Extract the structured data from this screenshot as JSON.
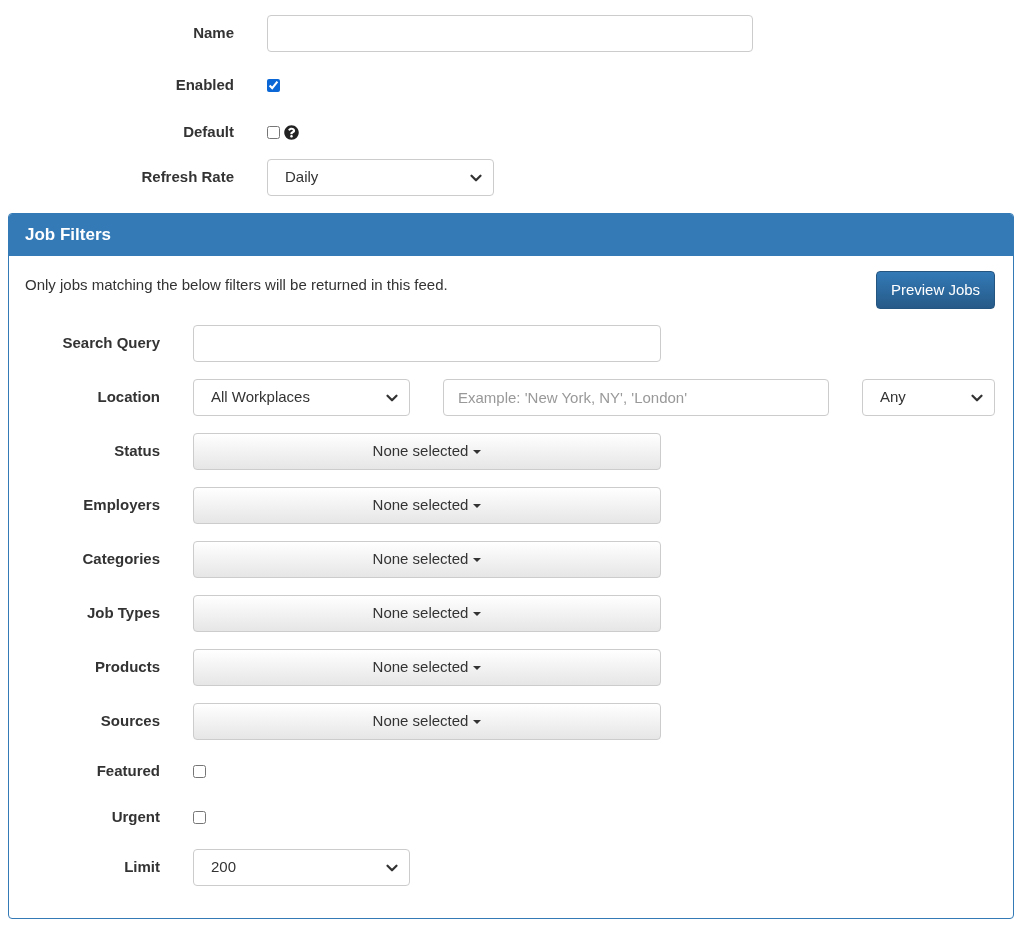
{
  "settings": [
    {
      "label": "Name",
      "controls": [
        {
          "kind": "text"
        }
      ]
    },
    {
      "label": "Enabled",
      "controls": [
        {
          "kind": "checkbox",
          "checked": true
        }
      ]
    },
    {
      "label": "Default",
      "controls": [
        {
          "kind": "checkbox",
          "checked": false,
          "help": true
        }
      ]
    },
    {
      "label": "Refresh Rate",
      "controls": [
        {
          "kind": "select",
          "value": "Daily"
        }
      ]
    }
  ],
  "panel": {
    "title": "Job Filters",
    "intro": "Only jobs matching the below filters will be returned in this feed.",
    "button": "Preview Jobs",
    "rows": [
      {
        "label": "Search Query",
        "controls": [
          {
            "kind": "text"
          }
        ]
      },
      {
        "label": "Location",
        "controls": [
          {
            "kind": "select",
            "value": "All Workplaces"
          },
          {
            "kind": "text",
            "placeholder": "Example: 'New York, NY', 'London'"
          },
          {
            "kind": "select",
            "value": "Any"
          }
        ]
      },
      {
        "label": "Status",
        "controls": [
          {
            "kind": "multiselect",
            "value": "None selected"
          }
        ]
      },
      {
        "label": "Employers",
        "controls": [
          {
            "kind": "multiselect",
            "value": "None selected"
          }
        ]
      },
      {
        "label": "Categories",
        "controls": [
          {
            "kind": "multiselect",
            "value": "None selected"
          }
        ]
      },
      {
        "label": "Job Types",
        "controls": [
          {
            "kind": "multiselect",
            "value": "None selected"
          }
        ]
      },
      {
        "label": "Products",
        "controls": [
          {
            "kind": "multiselect",
            "value": "None selected"
          }
        ]
      },
      {
        "label": "Sources",
        "controls": [
          {
            "kind": "multiselect",
            "value": "None selected"
          }
        ]
      },
      {
        "label": "Featured",
        "controls": [
          {
            "kind": "checkbox",
            "checked": false
          }
        ]
      },
      {
        "label": "Urgent",
        "controls": [
          {
            "kind": "checkbox",
            "checked": false
          }
        ]
      },
      {
        "label": "Limit",
        "controls": [
          {
            "kind": "select",
            "value": "200"
          }
        ]
      }
    ]
  }
}
